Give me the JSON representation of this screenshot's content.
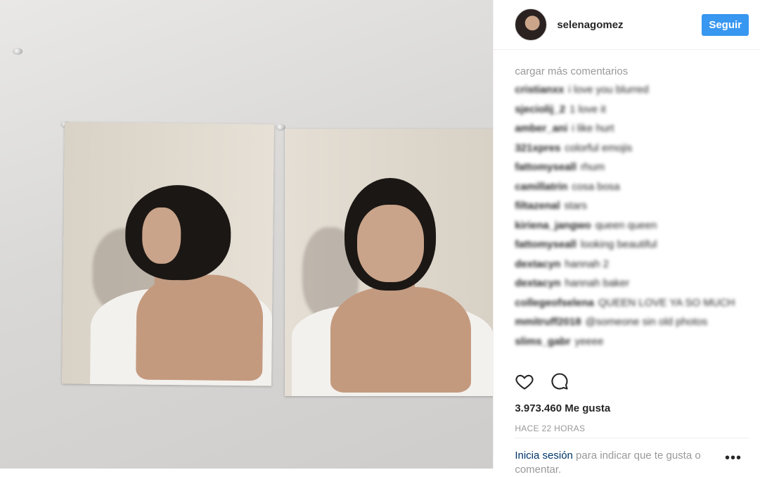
{
  "header": {
    "username": "selenagomez",
    "follow_label": "Seguir"
  },
  "comments": {
    "load_more": "cargar más comentarios",
    "items": [
      {
        "user": "cristianxx",
        "text": "i love you blurred"
      },
      {
        "user": "sjeciolij_2",
        "text": "1 love it"
      },
      {
        "user": "amber_ani",
        "text": "i like hurt"
      },
      {
        "user": "321xpres",
        "text": "colorful emojis"
      },
      {
        "user": "fattomyseall",
        "text": "rhum"
      },
      {
        "user": "camillatrin",
        "text": "cosa bosa"
      },
      {
        "user": "filtazenal",
        "text": "stars"
      },
      {
        "user": "kiriena_jangwo",
        "text": "queen queen"
      },
      {
        "user": "fattomyseall",
        "text": "looking beautiful"
      },
      {
        "user": "dextacyn",
        "text": "hannah 2"
      },
      {
        "user": "dextacyn",
        "text": "hannah baker"
      },
      {
        "user": "collegeofselena",
        "text": "QUEEN LOVE YA SO MUCH"
      },
      {
        "user": "mmitruff2018",
        "text": "@someone sin old photos"
      },
      {
        "user": "slims_gabr",
        "text": "yeeee"
      }
    ]
  },
  "actions": {
    "like_icon": "heart-icon",
    "comment_icon": "comment-bubble-icon"
  },
  "likes": "3.973.460 Me gusta",
  "timestamp": "HACE 22 HORAS",
  "login_prompt": {
    "link": "Inicia sesión",
    "text": " para indicar que te gusta o comentar."
  },
  "more_label": "•••",
  "colors": {
    "accent": "#3897f0",
    "link": "#003569",
    "muted": "#999999"
  }
}
